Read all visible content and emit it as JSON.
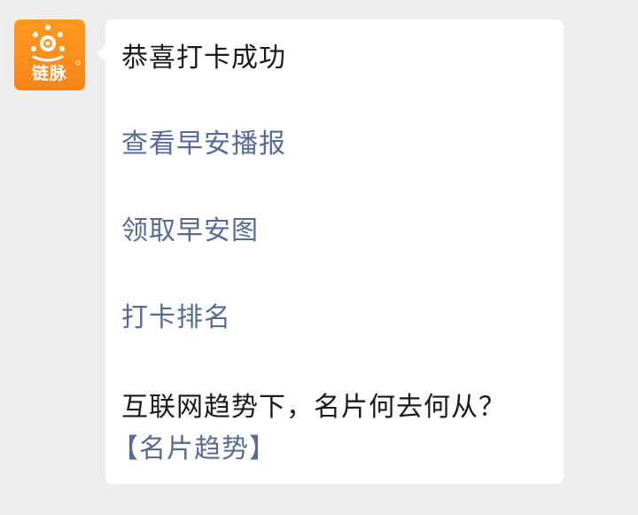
{
  "avatar": {
    "logo_text": "链脉",
    "bg_color": "#f7871c",
    "icon": "sun-logo-icon"
  },
  "message": {
    "title": "恭喜打卡成功",
    "links": [
      {
        "label": "查看早安播报"
      },
      {
        "label": "领取早安图"
      },
      {
        "label": "打卡排名"
      }
    ],
    "footer_text": "互联网趋势下，名片何去何从？",
    "footer_link": "【名片趋势】"
  },
  "colors": {
    "link": "#576b95",
    "text": "#1a1a1a",
    "background": "#ededed",
    "bubble": "#ffffff"
  }
}
